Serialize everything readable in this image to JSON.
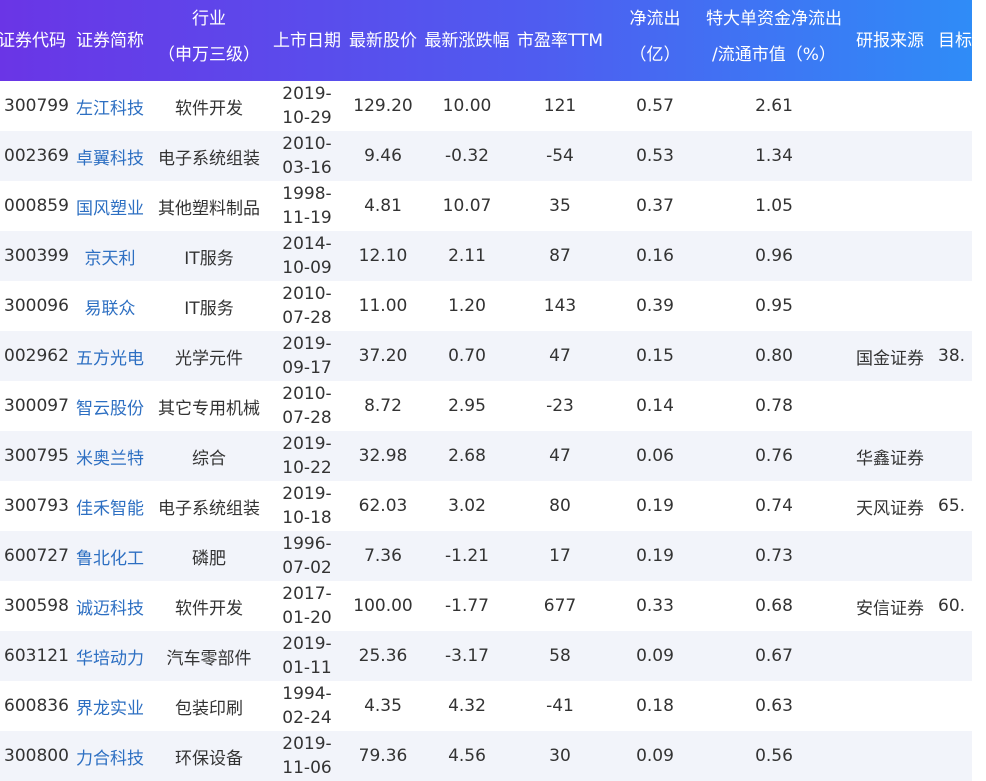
{
  "headers": [
    {
      "lines": [
        "证券代码"
      ]
    },
    {
      "lines": [
        "证券简称"
      ]
    },
    {
      "lines": [
        "行业",
        "（申万三级）"
      ]
    },
    {
      "lines": [
        "上市日期"
      ]
    },
    {
      "lines": [
        "最新股价"
      ]
    },
    {
      "lines": [
        "最新涨跌幅"
      ]
    },
    {
      "lines": [
        "市盈率TTM"
      ]
    },
    {
      "lines": [
        "净流出",
        "（亿）"
      ]
    },
    {
      "lines": [
        "特大单资金净流出",
        "/流通市值（%）"
      ]
    },
    {
      "lines": [
        "研报来源"
      ]
    },
    {
      "lines": [
        "目标"
      ]
    }
  ],
  "rows": [
    {
      "code": "300799",
      "name": "左江科技",
      "industry": "软件开发",
      "date": [
        "2019-",
        "10-29"
      ],
      "price": "129.20",
      "change": "10.00",
      "pe": "121",
      "outflow": "0.57",
      "ratio": "2.61",
      "source": "",
      "target": ""
    },
    {
      "code": "002369",
      "name": "卓翼科技",
      "industry": "电子系统组装",
      "date": [
        "2010-",
        "03-16"
      ],
      "price": "9.46",
      "change": "-0.32",
      "pe": "-54",
      "outflow": "0.53",
      "ratio": "1.34",
      "source": "",
      "target": ""
    },
    {
      "code": "000859",
      "name": "国风塑业",
      "industry": "其他塑料制品",
      "date": [
        "1998-",
        "11-19"
      ],
      "price": "4.81",
      "change": "10.07",
      "pe": "35",
      "outflow": "0.37",
      "ratio": "1.05",
      "source": "",
      "target": ""
    },
    {
      "code": "300399",
      "name": "京天利",
      "industry": "IT服务",
      "date": [
        "2014-",
        "10-09"
      ],
      "price": "12.10",
      "change": "2.11",
      "pe": "87",
      "outflow": "0.16",
      "ratio": "0.96",
      "source": "",
      "target": ""
    },
    {
      "code": "300096",
      "name": "易联众",
      "industry": "IT服务",
      "date": [
        "2010-",
        "07-28"
      ],
      "price": "11.00",
      "change": "1.20",
      "pe": "143",
      "outflow": "0.39",
      "ratio": "0.95",
      "source": "",
      "target": ""
    },
    {
      "code": "002962",
      "name": "五方光电",
      "industry": "光学元件",
      "date": [
        "2019-",
        "09-17"
      ],
      "price": "37.20",
      "change": "0.70",
      "pe": "47",
      "outflow": "0.15",
      "ratio": "0.80",
      "source": "国金证券",
      "target": "38."
    },
    {
      "code": "300097",
      "name": "智云股份",
      "industry": "其它专用机械",
      "date": [
        "2010-",
        "07-28"
      ],
      "price": "8.72",
      "change": "2.95",
      "pe": "-23",
      "outflow": "0.14",
      "ratio": "0.78",
      "source": "",
      "target": ""
    },
    {
      "code": "300795",
      "name": "米奥兰特",
      "industry": "综合",
      "date": [
        "2019-",
        "10-22"
      ],
      "price": "32.98",
      "change": "2.68",
      "pe": "47",
      "outflow": "0.06",
      "ratio": "0.76",
      "source": "华鑫证券",
      "target": ""
    },
    {
      "code": "300793",
      "name": "佳禾智能",
      "industry": "电子系统组装",
      "date": [
        "2019-",
        "10-18"
      ],
      "price": "62.03",
      "change": "3.02",
      "pe": "80",
      "outflow": "0.19",
      "ratio": "0.74",
      "source": "天风证券",
      "target": "65."
    },
    {
      "code": "600727",
      "name": "鲁北化工",
      "industry": "磷肥",
      "date": [
        "1996-",
        "07-02"
      ],
      "price": "7.36",
      "change": "-1.21",
      "pe": "17",
      "outflow": "0.19",
      "ratio": "0.73",
      "source": "",
      "target": ""
    },
    {
      "code": "300598",
      "name": "诚迈科技",
      "industry": "软件开发",
      "date": [
        "2017-",
        "01-20"
      ],
      "price": "100.00",
      "change": "-1.77",
      "pe": "677",
      "outflow": "0.33",
      "ratio": "0.68",
      "source": "安信证券",
      "target": "60."
    },
    {
      "code": "603121",
      "name": "华培动力",
      "industry": "汽车零部件",
      "date": [
        "2019-",
        "01-11"
      ],
      "price": "25.36",
      "change": "-3.17",
      "pe": "58",
      "outflow": "0.09",
      "ratio": "0.67",
      "source": "",
      "target": ""
    },
    {
      "code": "600836",
      "name": "界龙实业",
      "industry": "包装印刷",
      "date": [
        "1994-",
        "02-24"
      ],
      "price": "4.35",
      "change": "4.32",
      "pe": "-41",
      "outflow": "0.18",
      "ratio": "0.63",
      "source": "",
      "target": ""
    },
    {
      "code": "300800",
      "name": "力合科技",
      "industry": "环保设备",
      "date": [
        "2019-",
        "11-06"
      ],
      "price": "79.36",
      "change": "4.56",
      "pe": "30",
      "outflow": "0.09",
      "ratio": "0.56",
      "source": "",
      "target": ""
    }
  ]
}
